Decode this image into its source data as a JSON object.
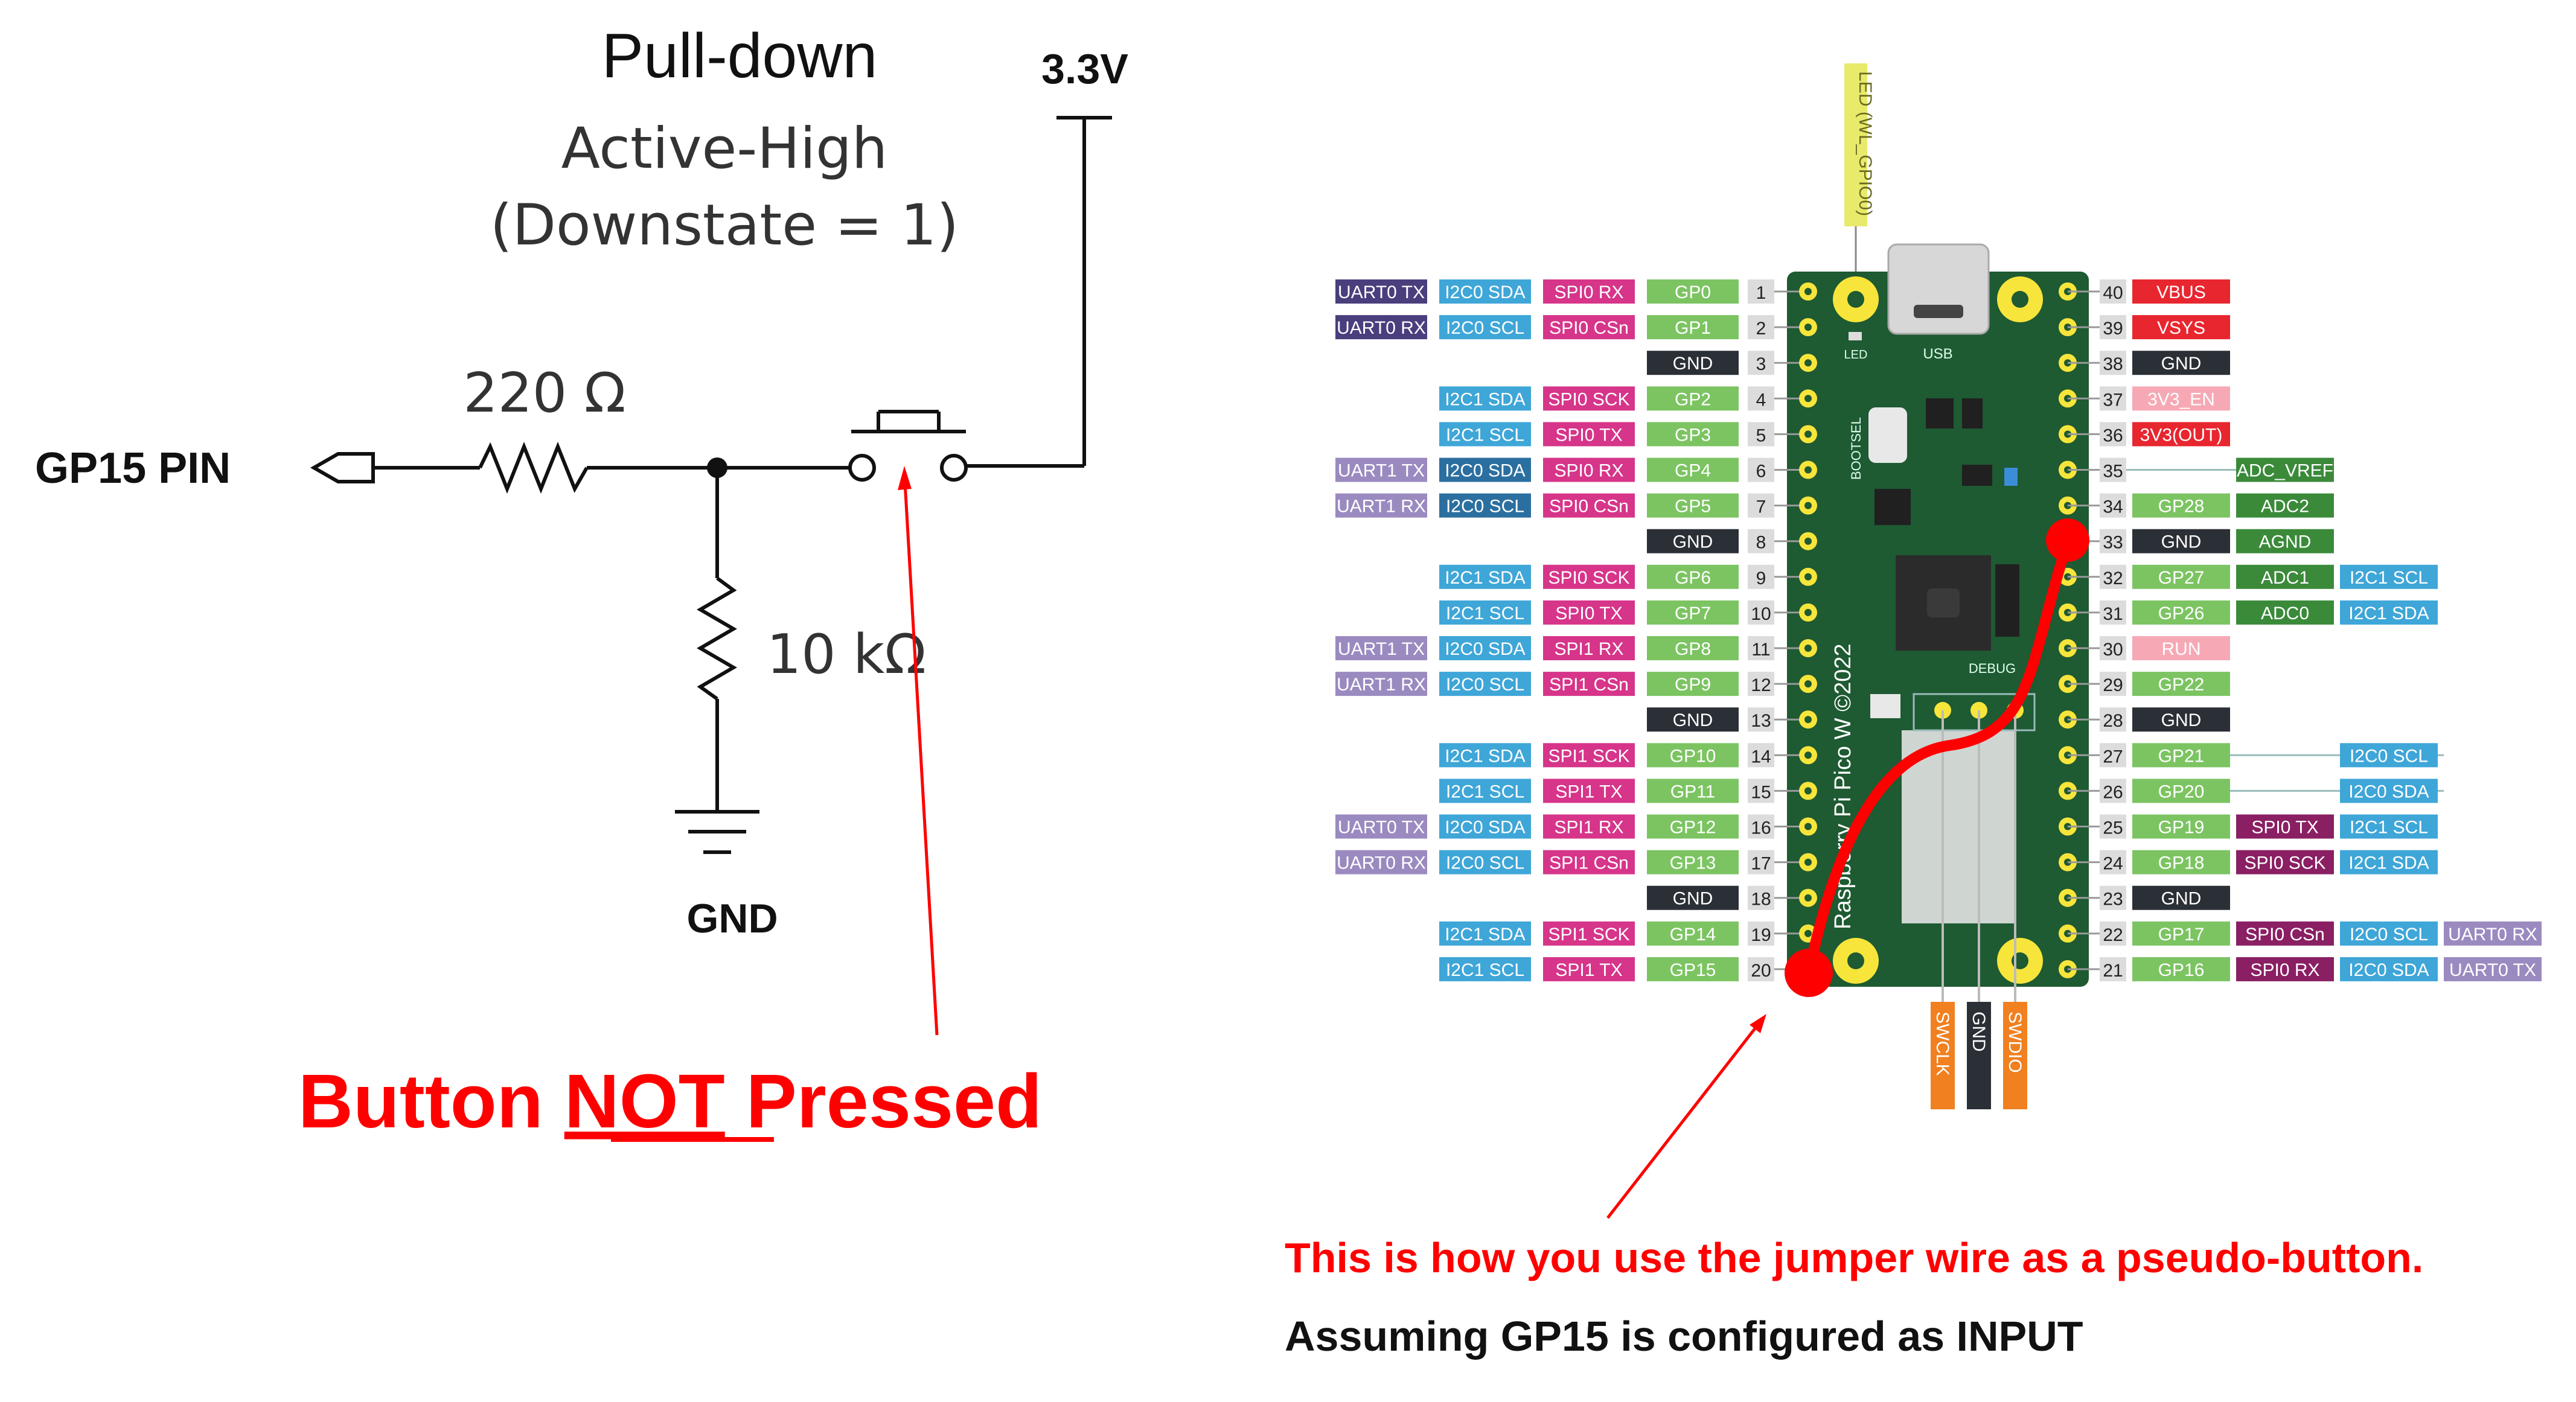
{
  "colors": {
    "annotation_red": "#ff0000",
    "board_green": "#1e5a32",
    "label_uart": "#4b3e7d",
    "label_uart_light": "#9b8ac0",
    "label_i2c": "#3fa6d8",
    "label_i2c_dark": "#2b6fa0",
    "label_spi": "#d6358a",
    "label_spi_dark": "#8a1f63",
    "label_gp": "#7cc462",
    "label_gnd": "#2b2f36",
    "label_power_red": "#e8262f",
    "label_pink": "#f6a9b5",
    "label_adc": "#3a8a3a",
    "label_orange": "#f08020",
    "label_yellow": "#e7ea6a"
  },
  "schematic": {
    "title": "Pull-down",
    "subtitle": "Active-High",
    "subtitle2": "(Downstate = 1)",
    "supply_label": "3.3V",
    "pin_label": "GP15 PIN",
    "resistor1_label": "220 Ω",
    "resistor2_label": "10 kΩ",
    "ground_label": "GND",
    "status_label_part1": "Button ",
    "status_label_part2": "NOT",
    "status_label_part3": " Pressed"
  },
  "board": {
    "led_label": "LED (WL_GPIO0)",
    "usb_label": "USB",
    "led_text": "LED",
    "bootsel_label": "BOOTSEL",
    "debug_label": "DEBUG",
    "board_name": "Raspberry Pi Pico W ©2022",
    "debug_pins": [
      "SWCLK",
      "GND",
      "SWDIO"
    ],
    "left_pins": [
      {
        "num": "1",
        "labels": [
          "UART0 TX",
          "I2C0 SDA",
          "SPI0 RX",
          "GP0"
        ],
        "colors": [
          "label_uart",
          "label_i2c",
          "label_spi",
          "label_gp"
        ]
      },
      {
        "num": "2",
        "labels": [
          "UART0 RX",
          "I2C0 SCL",
          "SPI0 CSn",
          "GP1"
        ],
        "colors": [
          "label_uart",
          "label_i2c",
          "label_spi",
          "label_gp"
        ]
      },
      {
        "num": "3",
        "labels": [
          "GND"
        ],
        "colors": [
          "label_gnd"
        ]
      },
      {
        "num": "4",
        "labels": [
          "I2C1 SDA",
          "SPI0 SCK",
          "GP2"
        ],
        "colors": [
          "label_i2c",
          "label_spi",
          "label_gp"
        ]
      },
      {
        "num": "5",
        "labels": [
          "I2C1 SCL",
          "SPI0 TX",
          "GP3"
        ],
        "colors": [
          "label_i2c",
          "label_spi",
          "label_gp"
        ]
      },
      {
        "num": "6",
        "labels": [
          "UART1 TX",
          "I2C0 SDA",
          "SPI0 RX",
          "GP4"
        ],
        "colors": [
          "label_uart_light",
          "label_i2c_dark",
          "label_spi",
          "label_gp"
        ]
      },
      {
        "num": "7",
        "labels": [
          "UART1 RX",
          "I2C0 SCL",
          "SPI0 CSn",
          "GP5"
        ],
        "colors": [
          "label_uart_light",
          "label_i2c_dark",
          "label_spi",
          "label_gp"
        ]
      },
      {
        "num": "8",
        "labels": [
          "GND"
        ],
        "colors": [
          "label_gnd"
        ]
      },
      {
        "num": "9",
        "labels": [
          "I2C1 SDA",
          "SPI0 SCK",
          "GP6"
        ],
        "colors": [
          "label_i2c",
          "label_spi",
          "label_gp"
        ]
      },
      {
        "num": "10",
        "labels": [
          "I2C1 SCL",
          "SPI0 TX",
          "GP7"
        ],
        "colors": [
          "label_i2c",
          "label_spi",
          "label_gp"
        ]
      },
      {
        "num": "11",
        "labels": [
          "UART1 TX",
          "I2C0 SDA",
          "SPI1 RX",
          "GP8"
        ],
        "colors": [
          "label_uart_light",
          "label_i2c",
          "label_spi",
          "label_gp"
        ]
      },
      {
        "num": "12",
        "labels": [
          "UART1 RX",
          "I2C0 SCL",
          "SPI1 CSn",
          "GP9"
        ],
        "colors": [
          "label_uart_light",
          "label_i2c",
          "label_spi",
          "label_gp"
        ]
      },
      {
        "num": "13",
        "labels": [
          "GND"
        ],
        "colors": [
          "label_gnd"
        ]
      },
      {
        "num": "14",
        "labels": [
          "I2C1 SDA",
          "SPI1 SCK",
          "GP10"
        ],
        "colors": [
          "label_i2c",
          "label_spi",
          "label_gp"
        ]
      },
      {
        "num": "15",
        "labels": [
          "I2C1 SCL",
          "SPI1 TX",
          "GP11"
        ],
        "colors": [
          "label_i2c",
          "label_spi",
          "label_gp"
        ]
      },
      {
        "num": "16",
        "labels": [
          "UART0 TX",
          "I2C0 SDA",
          "SPI1 RX",
          "GP12"
        ],
        "colors": [
          "label_uart_light",
          "label_i2c",
          "label_spi",
          "label_gp"
        ]
      },
      {
        "num": "17",
        "labels": [
          "UART0 RX",
          "I2C0 SCL",
          "SPI1 CSn",
          "GP13"
        ],
        "colors": [
          "label_uart_light",
          "label_i2c",
          "label_spi",
          "label_gp"
        ]
      },
      {
        "num": "18",
        "labels": [
          "GND"
        ],
        "colors": [
          "label_gnd"
        ]
      },
      {
        "num": "19",
        "labels": [
          "I2C1 SDA",
          "SPI1 SCK",
          "GP14"
        ],
        "colors": [
          "label_i2c",
          "label_spi",
          "label_gp"
        ]
      },
      {
        "num": "20",
        "labels": [
          "I2C1 SCL",
          "SPI1 TX",
          "GP15"
        ],
        "colors": [
          "label_i2c",
          "label_spi",
          "label_gp"
        ]
      }
    ],
    "right_pins": [
      {
        "num": "40",
        "labels": [
          "VBUS"
        ],
        "colors": [
          "label_power_red"
        ]
      },
      {
        "num": "39",
        "labels": [
          "VSYS"
        ],
        "colors": [
          "label_power_red"
        ]
      },
      {
        "num": "38",
        "labels": [
          "GND"
        ],
        "colors": [
          "label_gnd"
        ]
      },
      {
        "num": "37",
        "labels": [
          "3V3_EN"
        ],
        "colors": [
          "label_pink"
        ]
      },
      {
        "num": "36",
        "labels": [
          "3V3(OUT)"
        ],
        "colors": [
          "label_power_red"
        ]
      },
      {
        "num": "35",
        "labels": [
          "ADC_VREF"
        ],
        "colors": [
          "label_adc"
        ],
        "offset": 1
      },
      {
        "num": "34",
        "labels": [
          "GP28",
          "ADC2"
        ],
        "colors": [
          "label_gp",
          "label_adc"
        ]
      },
      {
        "num": "33",
        "labels": [
          "GND",
          "AGND"
        ],
        "colors": [
          "label_gnd",
          "label_adc"
        ]
      },
      {
        "num": "32",
        "labels": [
          "GP27",
          "ADC1",
          "I2C1 SCL"
        ],
        "colors": [
          "label_gp",
          "label_adc",
          "label_i2c"
        ]
      },
      {
        "num": "31",
        "labels": [
          "GP26",
          "ADC0",
          "I2C1 SDA"
        ],
        "colors": [
          "label_gp",
          "label_adc",
          "label_i2c"
        ]
      },
      {
        "num": "30",
        "labels": [
          "RUN"
        ],
        "colors": [
          "label_pink"
        ]
      },
      {
        "num": "29",
        "labels": [
          "GP22"
        ],
        "colors": [
          "label_gp"
        ]
      },
      {
        "num": "28",
        "labels": [
          "GND"
        ],
        "colors": [
          "label_gnd"
        ]
      },
      {
        "num": "27",
        "labels": [
          "GP21",
          "I2C0 SCL"
        ],
        "colors": [
          "label_gp",
          "label_i2c"
        ],
        "skip": 1
      },
      {
        "num": "26",
        "labels": [
          "GP20",
          "I2C0 SDA"
        ],
        "colors": [
          "label_gp",
          "label_i2c"
        ],
        "skip": 1
      },
      {
        "num": "25",
        "labels": [
          "GP19",
          "SPI0 TX",
          "I2C1 SCL"
        ],
        "colors": [
          "label_gp",
          "label_spi_dark",
          "label_i2c"
        ]
      },
      {
        "num": "24",
        "labels": [
          "GP18",
          "SPI0 SCK",
          "I2C1 SDA"
        ],
        "colors": [
          "label_gp",
          "label_spi_dark",
          "label_i2c"
        ]
      },
      {
        "num": "23",
        "labels": [
          "GND"
        ],
        "colors": [
          "label_gnd"
        ]
      },
      {
        "num": "22",
        "labels": [
          "GP17",
          "SPI0 CSn",
          "I2C0 SCL",
          "UART0 RX"
        ],
        "colors": [
          "label_gp",
          "label_spi_dark",
          "label_i2c",
          "label_uart_light"
        ]
      },
      {
        "num": "21",
        "labels": [
          "GP16",
          "SPI0 RX",
          "I2C0 SDA",
          "UART0 TX"
        ],
        "colors": [
          "label_gp",
          "label_spi_dark",
          "label_i2c",
          "label_uart_light"
        ]
      }
    ]
  },
  "annotation": {
    "line1": "This is how you use the jumper wire as a pseudo-button.",
    "line2": "Assuming GP15 is configured as INPUT"
  }
}
